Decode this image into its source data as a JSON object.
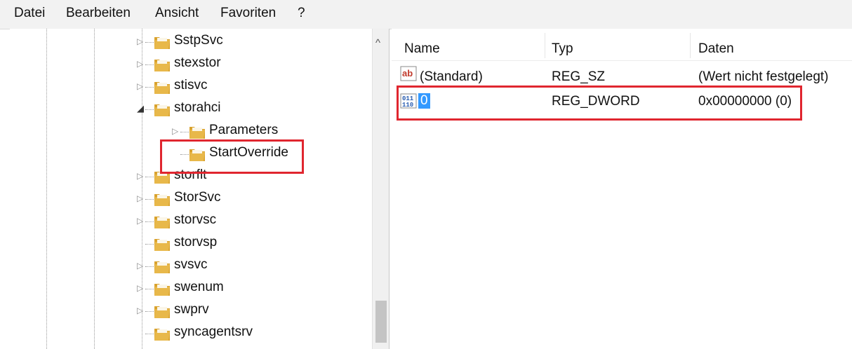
{
  "menu": [
    "Datei",
    "Bearbeiten",
    "Ansicht",
    "Favoriten",
    "?"
  ],
  "tree": {
    "items": [
      {
        "label": "SstpSvc",
        "expander": "▷"
      },
      {
        "label": "stexstor",
        "expander": "▷"
      },
      {
        "label": "stisvc",
        "expander": "▷"
      },
      {
        "label": "storahci",
        "expander": "◢"
      },
      {
        "label": "Parameters",
        "expander": "▷"
      },
      {
        "label": "StartOverride",
        "expander": ""
      },
      {
        "label": "storflt",
        "expander": "▷"
      },
      {
        "label": "StorSvc",
        "expander": "▷"
      },
      {
        "label": "storvsc",
        "expander": "▷"
      },
      {
        "label": "storvsp",
        "expander": ""
      },
      {
        "label": "svsvc",
        "expander": "▷"
      },
      {
        "label": "swenum",
        "expander": "▷"
      },
      {
        "label": "swprv",
        "expander": "▷"
      },
      {
        "label": "syncagentsrv",
        "expander": ""
      }
    ],
    "scroll_up_glyph": "^"
  },
  "list": {
    "headers": {
      "name": "Name",
      "type": "Typ",
      "data": "Daten"
    },
    "rows": [
      {
        "icon": "string-value-icon",
        "icon_text": "ab",
        "name": "(Standard)",
        "type": "REG_SZ",
        "data": "(Wert nicht festgelegt)"
      },
      {
        "icon": "binary-value-icon",
        "icon_text": "011\n110",
        "name": "0",
        "type": "REG_DWORD",
        "data": "0x00000000 (0)"
      }
    ]
  },
  "colors": {
    "highlight": "#e0262f",
    "selection": "#3399ff",
    "folder": "#e8b84a"
  }
}
